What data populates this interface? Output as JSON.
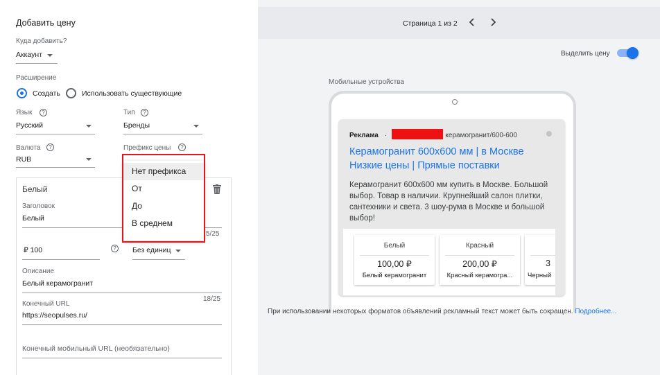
{
  "form": {
    "title": "Добавить цену",
    "where_label": "Куда добавить?",
    "where_value": "Аккаунт",
    "extension_label": "Расширение",
    "radio_create": "Создать",
    "radio_existing": "Использовать существующие",
    "language_label": "Язык",
    "language_value": "Русский",
    "type_label": "Тип",
    "type_value": "Бренды",
    "currency_label": "Валюта",
    "currency_value": "RUB",
    "prefix_label": "Префикс цены",
    "prefix_options": [
      "Нет префикса",
      "От",
      "До",
      "В среднем"
    ]
  },
  "item": {
    "name": "Белый",
    "header_label": "Заголовок",
    "header_value": "Белый",
    "header_count": "5/25",
    "price_value": "₽ 100",
    "unit_value": "Без единиц",
    "description_label": "Описание",
    "description_value": "Белый керамогранит",
    "description_count": "18/25",
    "url_label": "Конечный URL",
    "url_value": "https://seopulses.ru/",
    "mobile_url_label": "Конечный мобильный URL (необязательно)"
  },
  "preview": {
    "page_indicator": "Страница 1 из 2",
    "highlight_label": "Выделить цену",
    "device_label": "Мобильные устройства",
    "ad_badge": "Реклама",
    "ad_dot": "·",
    "ad_url_path": "керамогранит/600-600",
    "ad_title_line1": "Керамогранит 600х600 мм | в Москве",
    "ad_title_line2": "Низкие цены | Прямые поставки",
    "ad_description": "Керамогранит 600х600 мм купить в Москве. Большой выбор. Товар в наличии. Крупнейший салон плитки, сантехники и света. 3 шоу-рума в Москве и большой выбор!",
    "price_cards": [
      {
        "header": "Белый",
        "price": "100,00 ₽",
        "description": "Белый керамогранит"
      },
      {
        "header": "Красный",
        "price": "200,00 ₽",
        "description": "Красный керамогра..."
      },
      {
        "header": "",
        "price": "3",
        "description": "Черный"
      }
    ],
    "footer_note": "При использовании некоторых форматов объявлений рекламный текст может быть сокращен.",
    "footer_link": "Подробнее..."
  },
  "colors": {
    "accent": "#1a73e8",
    "highlight_box": "#e0161b",
    "redacted": "#ee1111"
  }
}
